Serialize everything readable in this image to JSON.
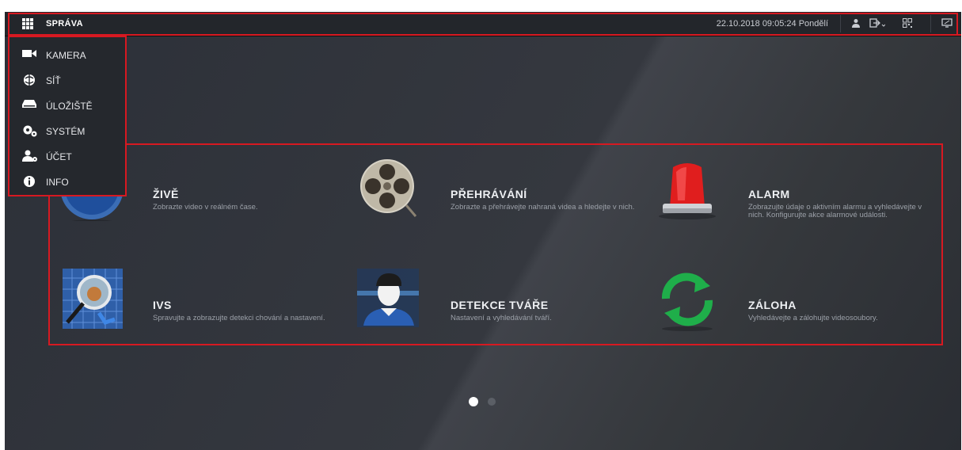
{
  "header": {
    "title": "SPRÁVA",
    "datetime": "22.10.2018 09:05:24 Pondělí",
    "icons": [
      "apps-grid-icon",
      "user-icon",
      "logout-icon",
      "qr-code-icon",
      "fullscreen-icon"
    ]
  },
  "sidebar": {
    "items": [
      {
        "label": "KAMERA",
        "icon": "camera-icon"
      },
      {
        "label": "SÍŤ",
        "icon": "network-icon"
      },
      {
        "label": "ÚLOŽIŠTĚ",
        "icon": "storage-icon"
      },
      {
        "label": "SYSTÉM",
        "icon": "gears-icon"
      },
      {
        "label": "ÚČET",
        "icon": "account-icon"
      },
      {
        "label": "INFO",
        "icon": "info-icon"
      }
    ]
  },
  "modules": [
    {
      "title": "ŽIVĚ",
      "desc": "Zobrazte video v reálném čase.",
      "icon": "live-icon"
    },
    {
      "title": "PŘEHRÁVÁNÍ",
      "desc": "Zobrazte a přehrávejte nahraná videa a hledejte v nich.",
      "icon": "film-reel-icon"
    },
    {
      "title": "ALARM",
      "desc": "Zobrazujte údaje o aktivním alarmu a vyhledávejte v nich. Konfigurujte akce alarmové události.",
      "icon": "alarm-siren-icon"
    },
    {
      "title": "IVS",
      "desc": "Spravujte a zobrazujte detekci chování a nastavení.",
      "icon": "magnifier-icon"
    },
    {
      "title": "DETEKCE TVÁŘE",
      "desc": "Nastavení a vyhledávání tváří.",
      "icon": "face-detection-icon"
    },
    {
      "title": "ZÁLOHA",
      "desc": "Vyhledávejte a zálohujte videosoubory.",
      "icon": "backup-refresh-icon"
    }
  ],
  "pagination": {
    "pages": 2,
    "active": 1
  },
  "colors": {
    "accent_red": "#d71921",
    "topbar": "#23262b",
    "sidebar": "#25282d",
    "background": "#35383f"
  }
}
